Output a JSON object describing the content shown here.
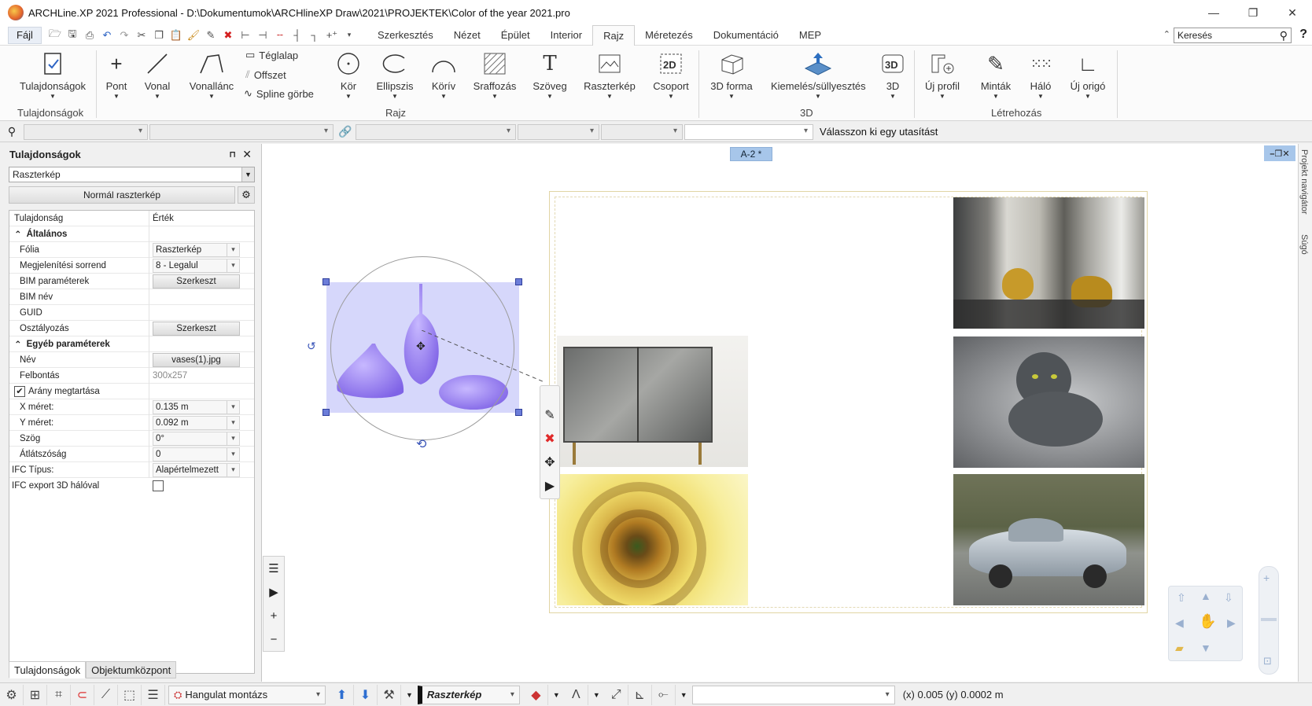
{
  "window": {
    "title": "ARCHLine.XP 2021  Professional - D:\\Dokumentumok\\ARCHlineXP Draw\\2021\\PROJEKTEK\\Color of the year 2021.pro",
    "minimize": "—",
    "restore": "❐",
    "close": "✕"
  },
  "menu": {
    "file": "Fájl",
    "tabs": [
      "Szerkesztés",
      "Nézet",
      "Épület",
      "Interior",
      "Rajz",
      "Méretezés",
      "Dokumentáció",
      "MEP"
    ],
    "active_tab": "Rajz",
    "search_placeholder": "Keresés",
    "help": "?"
  },
  "ribbon": {
    "items": {
      "tulajdonsagok": "Tulajdonságok",
      "pont": "Pont",
      "vonal": "Vonal",
      "vonallanc": "Vonallánc",
      "teglalap": "Téglalap",
      "offszet": "Offszet",
      "spline": "Spline görbe",
      "kor": "Kör",
      "ellipszis": "Ellipszis",
      "korív": "Körív",
      "sraffozas": "Sraffozás",
      "szoveg": "Szöveg",
      "raszterkep": "Raszterkép",
      "csoport": "Csoport",
      "forma3d": "3D forma",
      "kiemeles": "Kiemelés/süllyesztés",
      "d3": "3D",
      "ujprofil": "Új profil",
      "mintak": "Minták",
      "halo": "Háló",
      "ujorigo": "Új origó"
    },
    "groups": {
      "g1": "Tulajdonságok",
      "g2": "Rajz",
      "g3": "3D",
      "g4": "Létrehozás"
    }
  },
  "command": {
    "prompt": "Válasszon ki egy utasítást"
  },
  "panel": {
    "title": "Tulajdonságok",
    "type_select": "Raszterkép",
    "mode_button": "Normál raszterkép",
    "header_key": "Tulajdonság",
    "header_value": "Érték",
    "general": "Általános",
    "rows1": [
      {
        "k": "Fólia",
        "v": "Raszterkép"
      },
      {
        "k": "Megjelenítési sorrend",
        "v": "8 - Legalul"
      },
      {
        "k": "BIM paraméterek",
        "v": "Szerkeszt"
      },
      {
        "k": "BIM név",
        "v": ""
      },
      {
        "k": "GUID",
        "v": ""
      },
      {
        "k": "Osztályozás",
        "v": "Szerkeszt"
      }
    ],
    "other": "Egyéb paraméterek",
    "rows2": [
      {
        "k": "Név",
        "v": "vases(1).jpg"
      },
      {
        "k": "Felbontás",
        "v": "300x257"
      },
      {
        "k": "Arány megtartása",
        "v": ""
      },
      {
        "k": "X méret:",
        "v": "0.135 m"
      },
      {
        "k": "Y méret:",
        "v": "0.092 m"
      },
      {
        "k": "Szög",
        "v": "0°"
      },
      {
        "k": "Átlátszóság",
        "v": "0"
      },
      {
        "k": "IFC Típus:",
        "v": "Alapértelmezett"
      },
      {
        "k": "IFC export 3D hálóval",
        "v": ""
      }
    ],
    "tabs": [
      "Tulajdonságok",
      "Objektumközpont"
    ]
  },
  "canvas": {
    "sheet_tab": "A-2 *",
    "side_tabs": [
      "Projekt navigátor",
      "Súgó"
    ]
  },
  "status": {
    "layer_combo": "Hangulat montázs",
    "type_combo": "Raszterkép",
    "coords": "(x) 0.005   (y) 0.0002 m"
  }
}
